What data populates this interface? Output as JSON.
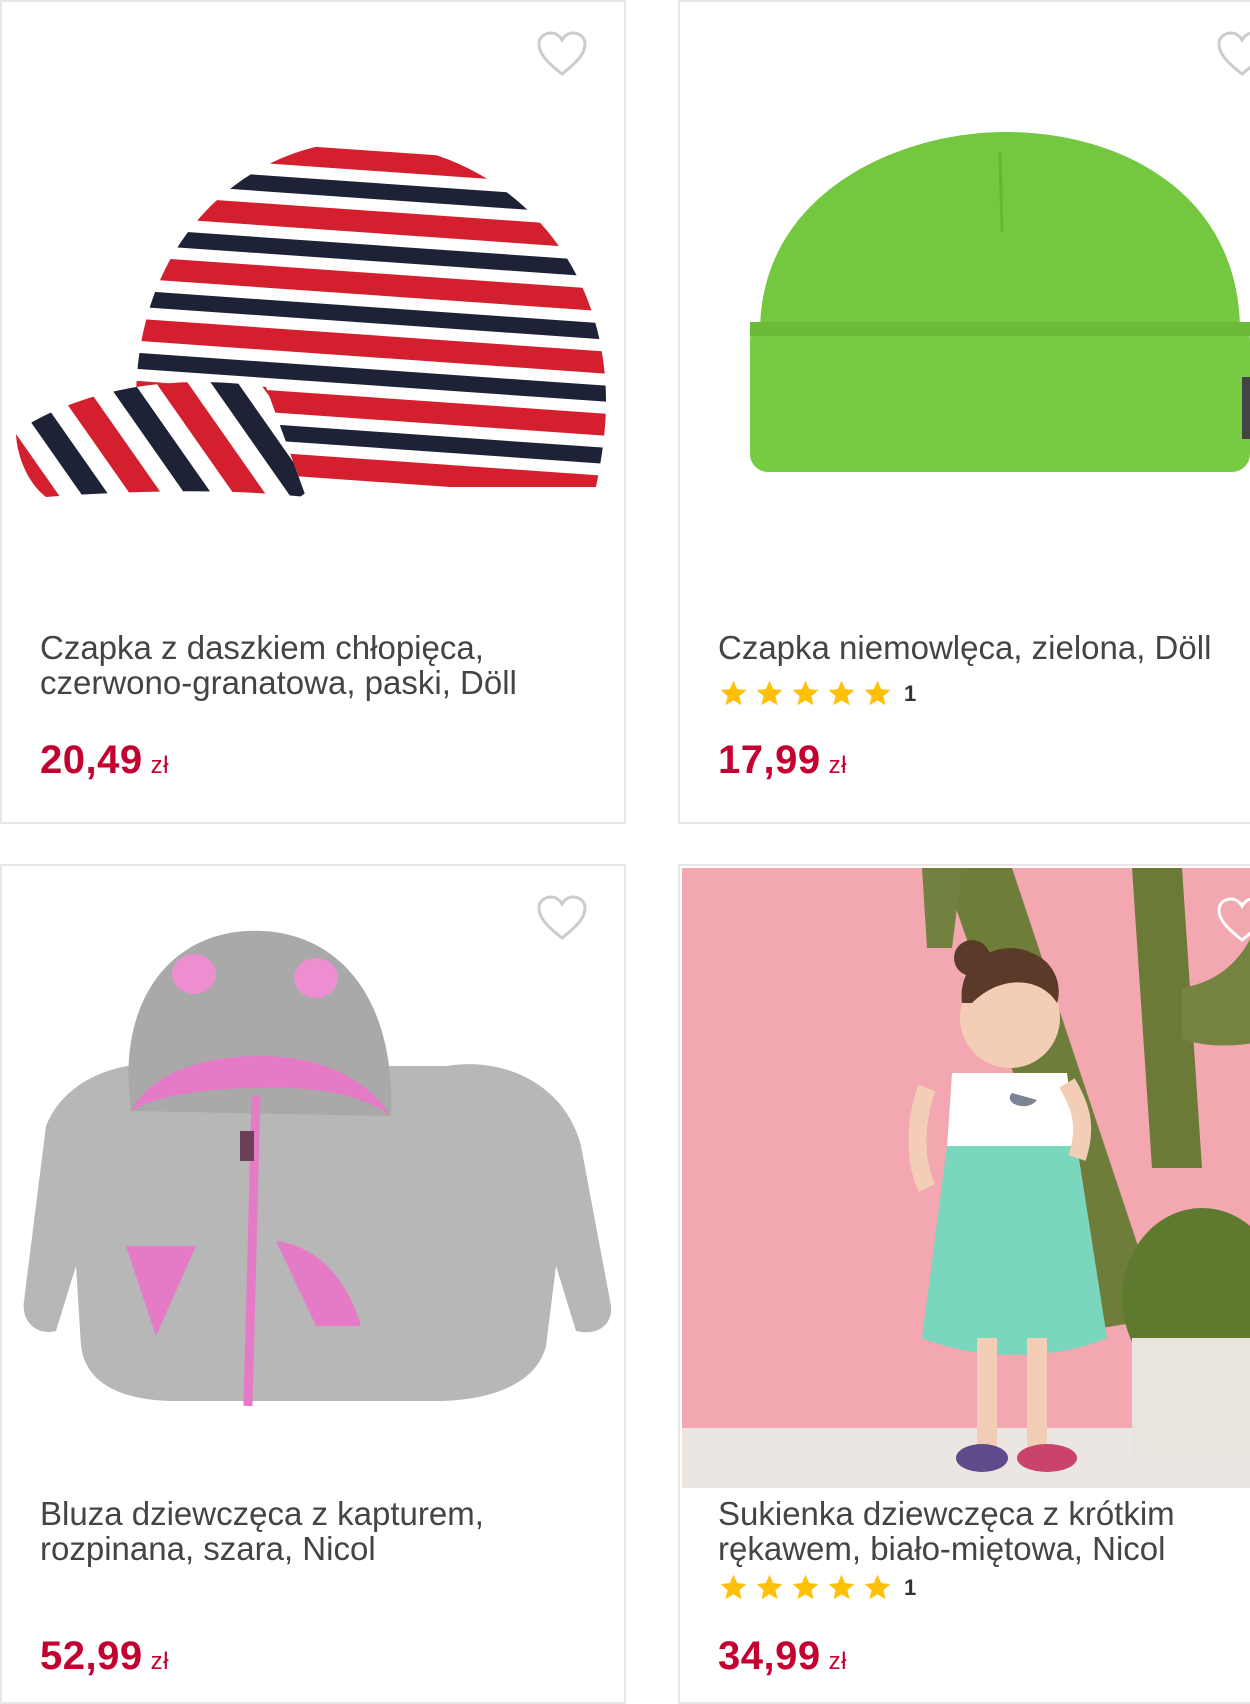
{
  "products": [
    {
      "title_line1": "Czapka z daszkiem chłopięca,",
      "title_line2": "czerwono-granatowa, paski, Döll",
      "price": "20,49",
      "currency": "zł",
      "image": "striped-cap",
      "favorite_icon": "heart-outline-icon"
    },
    {
      "title_line1": "Czapka niemowlęca, zielona, Döll",
      "title_line2": "",
      "rating": 5,
      "rating_count": "1",
      "price": "17,99",
      "currency": "zł",
      "image": "green-beanie",
      "favorite_icon": "heart-outline-icon"
    },
    {
      "title_line1": "Bluza dziewczęca z kapturem,",
      "title_line2": "rozpinana, szara, Nicol",
      "price": "52,99",
      "currency": "zł",
      "image": "grey-hoodie",
      "favorite_icon": "heart-outline-icon"
    },
    {
      "title_line1": "Sukienka dziewczęca z krótkim",
      "title_line2": "rękawem, biało-miętowa, Nicol",
      "rating": 5,
      "rating_count": "1",
      "price": "34,99",
      "currency": "zł",
      "image": "girl-dress-photo",
      "favorite_icon": "heart-outline-icon"
    }
  ],
  "colors": {
    "price": "#c3002f",
    "star": "#ffc107",
    "border": "#e6e6e6"
  }
}
